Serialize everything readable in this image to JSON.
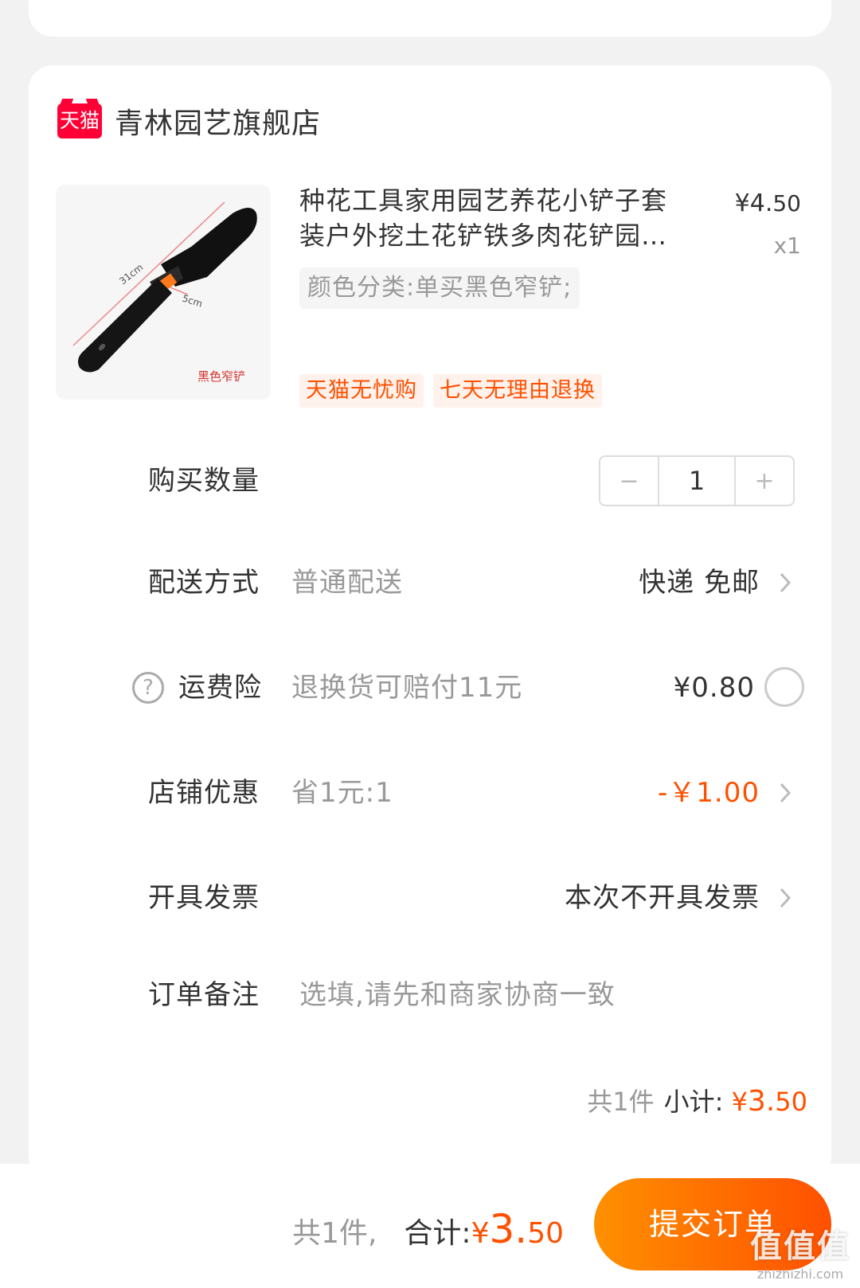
{
  "shop": {
    "name": "青林园艺旗舰店",
    "logo_text": "天猫"
  },
  "product": {
    "title": "种花工具家用园艺养花小铲子套装户外挖土花铲铁多肉花铲园艺工具",
    "price_symbol": "¥",
    "price_int": "4.",
    "price_dec": "50",
    "quantity_label": "x1",
    "sku": "颜色分类:单买黑色窄铲;",
    "image": {
      "length_label": "31cm",
      "width_label": "5cm",
      "caption": "黑色窄铲"
    },
    "tags": [
      "天猫无忧购",
      "七天无理由退换"
    ]
  },
  "quantity": {
    "label": "购买数量",
    "minus": "−",
    "value": "1",
    "plus": "+"
  },
  "delivery": {
    "label": "配送方式",
    "sub": "普通配送",
    "value": "快递 免邮"
  },
  "insurance": {
    "label": "运费险",
    "sub": "退换货可赔付11元",
    "value": "¥0.80"
  },
  "discount": {
    "label": "店铺优惠",
    "sub": "省1元:1",
    "value": "-￥1.00"
  },
  "invoice": {
    "label": "开具发票",
    "value": "本次不开具发票"
  },
  "note": {
    "label": "订单备注",
    "placeholder": "选填,请先和商家协商一致"
  },
  "subtotal": {
    "count": "共1件",
    "label": "小计:",
    "symbol": "¥",
    "int": "3.",
    "dec": "50"
  },
  "footer": {
    "count": "共1件,",
    "label": "合计:",
    "symbol": "¥",
    "int": "3.",
    "dec": "50",
    "submit": "提交订单"
  },
  "watermark": {
    "main": "值值值",
    "url": "zhizhizhi.com"
  },
  "colors": {
    "accent": "#ff5000",
    "tmall_red": "#ff0036",
    "background": "#f2f2f2"
  }
}
